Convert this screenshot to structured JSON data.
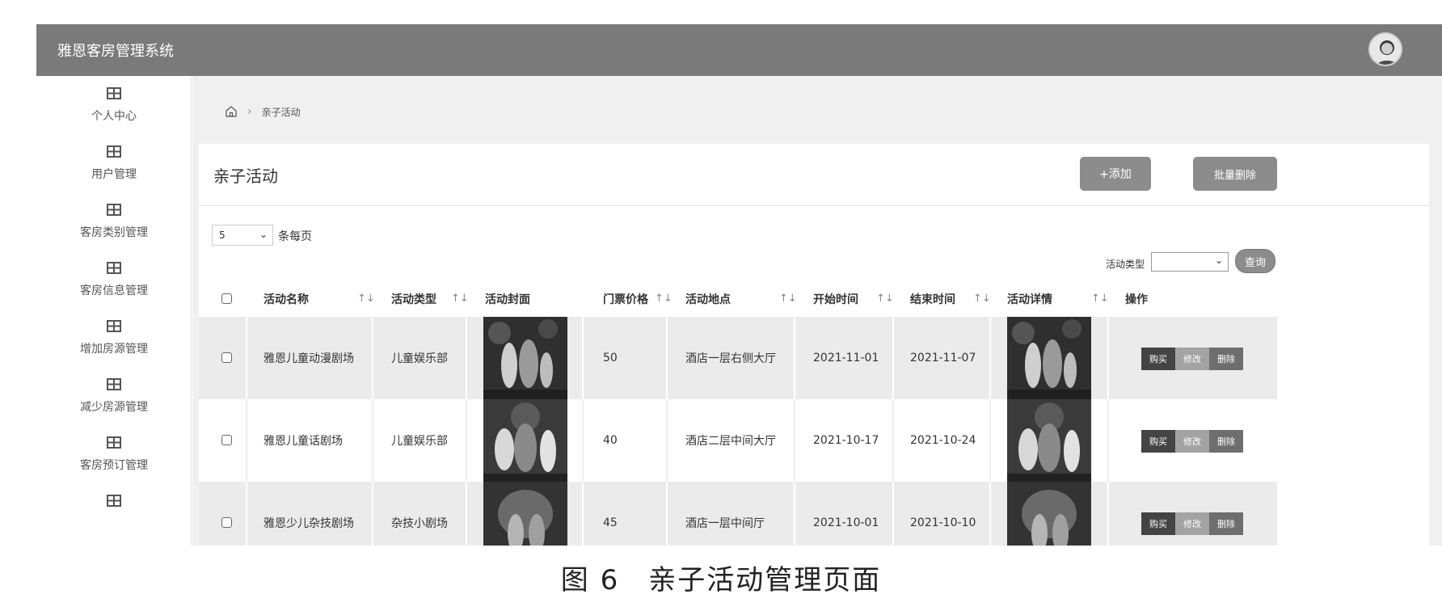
{
  "app": {
    "title": "雅恩客房管理系统",
    "avatar_icon": "user-avatar-icon"
  },
  "sidebar": {
    "items": [
      {
        "label": "个人中心",
        "icon": "grid-icon"
      },
      {
        "label": "用户管理",
        "icon": "grid-icon"
      },
      {
        "label": "客房类别管理",
        "icon": "grid-icon"
      },
      {
        "label": "客房信息管理",
        "icon": "grid-icon"
      },
      {
        "label": "增加房源管理",
        "icon": "grid-icon"
      },
      {
        "label": "减少房源管理",
        "icon": "grid-icon"
      },
      {
        "label": "客房预订管理",
        "icon": "grid-icon"
      },
      {
        "label": "",
        "icon": "grid-icon"
      }
    ]
  },
  "breadcrumb": {
    "home_icon": "home-icon",
    "current": "亲子活动"
  },
  "card": {
    "title": "亲子活动",
    "add_label": "+添加",
    "batch_delete_label": "批量删除"
  },
  "pagination": {
    "page_size": "5",
    "per_page_label": "条每页"
  },
  "filter": {
    "label": "活动类型",
    "value": "",
    "query_label": "查询"
  },
  "table": {
    "headers": {
      "name": "活动名称",
      "type": "活动类型",
      "cover": "活动封面",
      "price": "门票价格",
      "location": "活动地点",
      "start": "开始时间",
      "end": "结束时间",
      "detail": "活动详情",
      "actions": "操作"
    },
    "sort_glyph": "↑↓",
    "action_labels": {
      "buy": "购买",
      "edit": "修改",
      "delete": "删除"
    },
    "rows": [
      {
        "name": "雅恩儿童动漫剧场",
        "type": "儿童娱乐部",
        "price": "50",
        "location": "酒店一层右侧大厅",
        "start": "2021-11-01",
        "end": "2021-11-07"
      },
      {
        "name": "雅恩儿童话剧场",
        "type": "儿童娱乐部",
        "price": "40",
        "location": "酒店二层中间大厅",
        "start": "2021-10-17",
        "end": "2021-10-24"
      },
      {
        "name": "雅恩少儿杂技剧场",
        "type": "杂技小剧场",
        "price": "45",
        "location": "酒店一层中间厅",
        "start": "2021-10-01",
        "end": "2021-10-10"
      }
    ]
  },
  "caption": "图 6　亲子活动管理页面"
}
